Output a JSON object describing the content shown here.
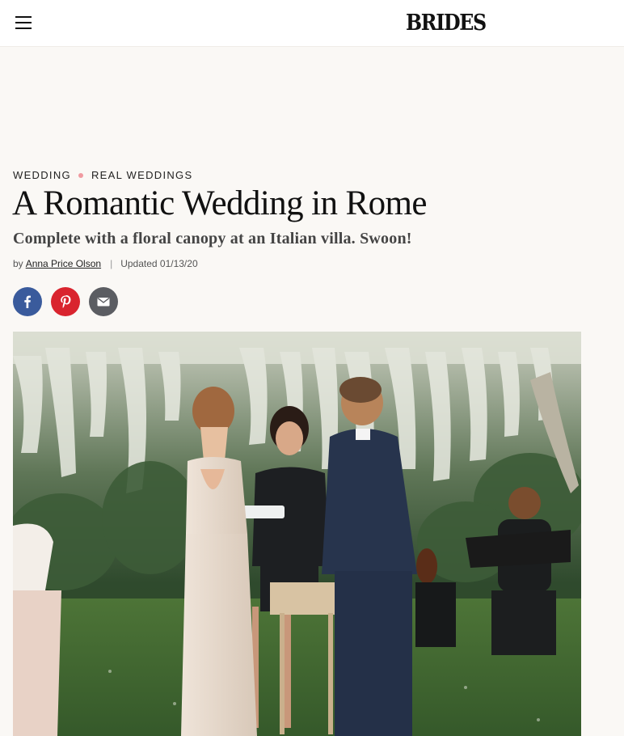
{
  "header": {
    "logo": "BRIDES",
    "menu_icon": "hamburger-menu-icon"
  },
  "breadcrumb": {
    "items": [
      "WEDDING",
      "REAL WEDDINGS"
    ]
  },
  "article": {
    "title": "A Romantic Wedding in Rome",
    "subtitle": "Complete with a floral canopy at an Italian villa. Swoon!",
    "by_prefix": "by",
    "author": "Anna Price Olson",
    "separator": "|",
    "updated": "Updated 01/13/20"
  },
  "share": {
    "buttons": [
      {
        "network": "facebook",
        "icon": "facebook-icon",
        "color": "#3a5b9c"
      },
      {
        "network": "pinterest",
        "icon": "pinterest-icon",
        "color": "#d9242e"
      },
      {
        "network": "email",
        "icon": "email-icon",
        "color": "#5b5d62"
      }
    ]
  },
  "colors": {
    "page_background": "#faf8f5",
    "breadcrumb_dot": "#f09aa0"
  }
}
